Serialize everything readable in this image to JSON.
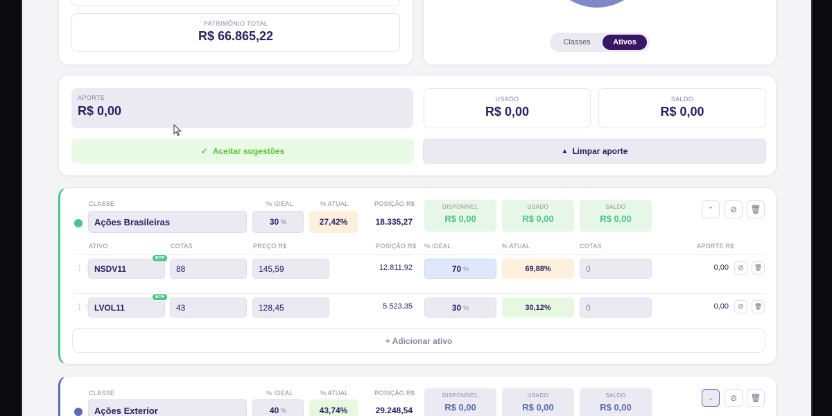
{
  "summary": {
    "patrimonio_label": "PATRIMÔNIO TOTAL",
    "patrimonio_value": "R$ 66.865,22",
    "toggle_classes": "Classes",
    "toggle_ativos": "Ativos"
  },
  "aporte": {
    "aporte_label": "APORTE",
    "aporte_value": "R$ 0,00",
    "usado_label": "USADO",
    "usado_value": "R$ 0,00",
    "saldo_label": "SALDO",
    "saldo_value": "R$ 0,00",
    "accept_label": "Aceitar sugestões",
    "clear_label": "Limpar aporte"
  },
  "classes": [
    {
      "classe_label": "CLASSE",
      "ideal_label": "% IDEAL",
      "atual_label": "% ATUAL",
      "posicao_label": "POSIÇÃO R$",
      "name": "Ações Brasileiras",
      "ideal": "30",
      "ideal_unit": "%",
      "atual": "27,42%",
      "posicao": "18.335,27",
      "disponivel_label": "DISPONÍVEL",
      "disponivel_value": "R$ 0,00",
      "usado_label": "USADO",
      "usado_value": "R$ 0,00",
      "saldo_label": "SALDO",
      "saldo_value": "R$ 0,00",
      "color": "#4cc38a",
      "headers": {
        "ativo": "ATIVO",
        "cotas": "COTAS",
        "preco": "PREÇO R$",
        "posicao": "POSIÇÃO R$",
        "ideal": "% IDEAL",
        "atual": "% ATUAL",
        "cotas2": "COTAS",
        "aporte": "APORTE R$"
      },
      "assets": [
        {
          "ticker": "NSDV11",
          "badge": "ETF",
          "cotas": "88",
          "preco": "145,59",
          "posicao": "12.811,92",
          "ideal": "70",
          "ideal_unit": "%",
          "atual": "69,88%",
          "cotas_aporte": "0",
          "aporte": "0,00"
        },
        {
          "ticker": "LVOL11",
          "badge": "ETF",
          "cotas": "43",
          "preco": "128,45",
          "posicao": "5.523,35",
          "ideal": "30",
          "ideal_unit": "%",
          "atual": "30,12%",
          "cotas_aporte": "0",
          "aporte": "0,00"
        }
      ],
      "add_label": "+ Adicionar ativo"
    },
    {
      "classe_label": "CLASSE",
      "ideal_label": "% IDEAL",
      "atual_label": "% ATUAL",
      "posicao_label": "POSIÇÃO R$",
      "name": "Ações Exterior",
      "ideal": "40",
      "ideal_unit": "%",
      "atual": "43,74%",
      "posicao": "29.248,54",
      "disponivel_label": "DISPONÍVEL",
      "disponivel_value": "R$ 0,00",
      "usado_label": "USADO",
      "usado_value": "R$ 0,00",
      "saldo_label": "SALDO",
      "saldo_value": "R$ 0,00",
      "color": "#5b6bb5"
    }
  ],
  "colors": {
    "green_accent": "#4cc38a",
    "blue_accent": "#5b6bb5",
    "primary_dark": "#3a1766",
    "text": "#2a2060"
  },
  "icons": {
    "check": "check-icon",
    "broom": "broom-icon",
    "chevron_up": "chevron-up-icon",
    "chevron_down": "chevron-down-icon",
    "ban": "ban-icon",
    "trash": "trash-icon",
    "drag": "drag-handle-icon",
    "cursor": "cursor-icon"
  }
}
